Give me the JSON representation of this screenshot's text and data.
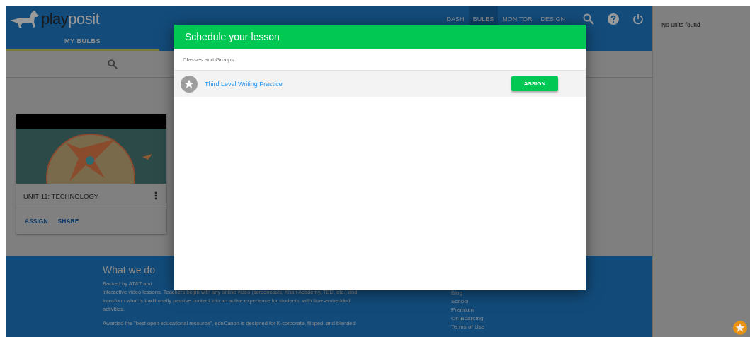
{
  "header": {
    "logo": {
      "part_1": "play",
      "part_2": "posit"
    },
    "nav": [
      {
        "label": "DASH",
        "selected": false
      },
      {
        "label": "BULBS",
        "selected": true
      },
      {
        "label": "MONITOR",
        "selected": false
      },
      {
        "label": "DESIGN",
        "selected": false
      }
    ]
  },
  "tabs": [
    {
      "label": "MY BULBS",
      "selected": true
    }
  ],
  "card": {
    "title": "UNIT 11: TECHNOLOGY",
    "actions": [
      "ASSIGN",
      "SHARE"
    ]
  },
  "footer": {
    "heading": "What we do",
    "paragraphs": [
      [
        "Backed by AT&T and",
        "interactive video lessons. Teachers begin with any online video (screencasts, Khan Academy, TED, etc.) and",
        "transform what is traditionally passive content into an active experience for students, with time-embedded",
        "activities."
      ],
      [
        "Awarded the \"best open educational resource\", eduCanon is designed for K-corporate, flipped, and blended"
      ]
    ],
    "links": [
      "Blog",
      "School",
      "Premium",
      "On-Boarding",
      "Terms of Use"
    ]
  },
  "side_panel": {
    "message": "No units found"
  },
  "modal": {
    "title": "Schedule your lesson",
    "section": "Classes and Groups",
    "groups": [
      {
        "name": "Third Level Writing Practice",
        "action": "ASSIGN"
      }
    ]
  }
}
